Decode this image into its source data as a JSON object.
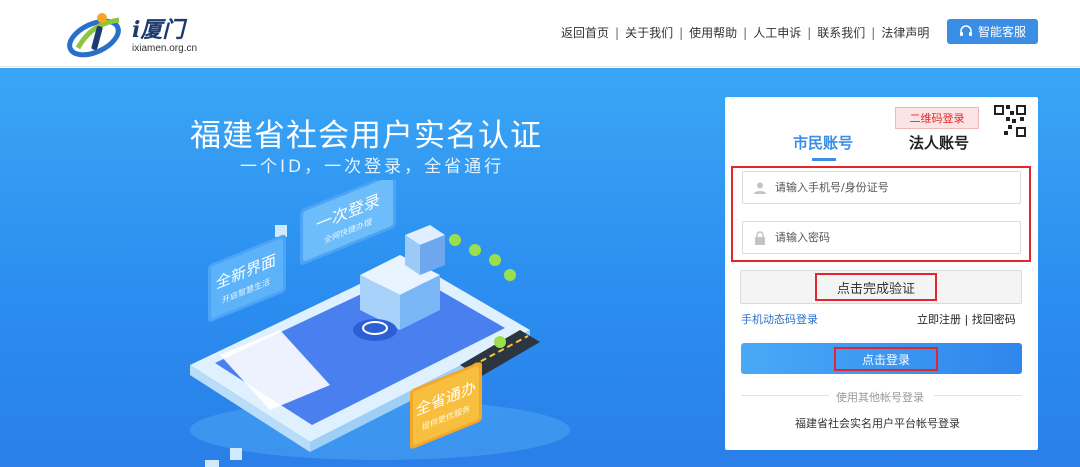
{
  "header": {
    "logo_text": "i厦门",
    "logo_url": "ixiamen.org.cn",
    "nav": [
      "返回首页",
      "关于我们",
      "使用帮助",
      "人工申诉",
      "联系我们",
      "法律声明"
    ],
    "service_label": "智能客服"
  },
  "hero": {
    "title": "福建省社会用户实名认证",
    "subtitle": "一个ID，一次登录，全省通行",
    "badges": {
      "new_ui": "全新界面",
      "new_ui_sub": "开启智慧生活",
      "one_login": "一次登录",
      "one_login_sub": "全网快捷办理",
      "province": "全省通办",
      "province_sub": "提供更优服务"
    }
  },
  "login": {
    "qr_tag": "二维码登录",
    "tabs": [
      "市民账号",
      "法人账号"
    ],
    "active_tab": "市民账号",
    "phone_placeholder": "请输入手机号/身份证号",
    "password_placeholder": "请输入密码",
    "verify_label": "点击完成验证",
    "sms_login": "手机动态码登录",
    "register": "立即注册",
    "forgot": "找回密码",
    "login_label": "点击登录",
    "other_login": "使用其他帐号登录",
    "platform_login": "福建省社会实名用户平台帐号登录"
  },
  "colors": {
    "accent": "#3a8ee6",
    "highlight": "#e0272d",
    "hero_top": "#3aa6f5",
    "hero_bottom": "#2a7fe8"
  }
}
